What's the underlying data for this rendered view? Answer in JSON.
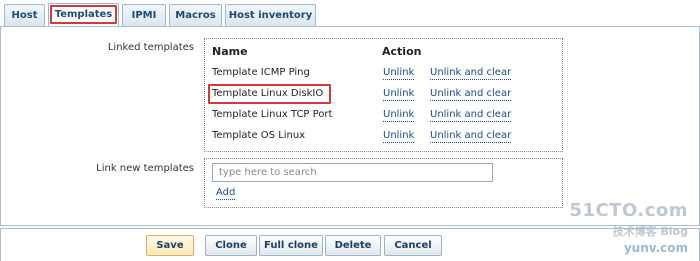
{
  "tabs": [
    {
      "label": "Host"
    },
    {
      "label": "Templates",
      "active": true
    },
    {
      "label": "IPMI"
    },
    {
      "label": "Macros"
    },
    {
      "label": "Host inventory"
    }
  ],
  "linked_templates": {
    "label": "Linked templates",
    "col_name": "Name",
    "col_action": "Action",
    "rows": [
      {
        "name": "Template ICMP Ping",
        "unlink": "Unlink",
        "unlink_clear": "Unlink and clear",
        "highlighted": false
      },
      {
        "name": "Template Linux DiskIO",
        "unlink": "Unlink",
        "unlink_clear": "Unlink and clear",
        "highlighted": true
      },
      {
        "name": "Template Linux TCP Port",
        "unlink": "Unlink",
        "unlink_clear": "Unlink and clear",
        "highlighted": false
      },
      {
        "name": "Template OS Linux",
        "unlink": "Unlink",
        "unlink_clear": "Unlink and clear",
        "highlighted": false
      }
    ]
  },
  "link_new": {
    "label": "Link new templates",
    "placeholder": "type here to search",
    "add_label": "Add"
  },
  "buttons": {
    "save": "Save",
    "clone": "Clone",
    "full_clone": "Full clone",
    "delete": "Delete",
    "cancel": "Cancel"
  },
  "watermark": {
    "line1": "51CTO.com",
    "line2": "技术博客  Blog",
    "line3": "yunv.com"
  },
  "colors": {
    "highlight": "#d13a3a",
    "link": "#1b4a86",
    "tab_text": "#1b4a73"
  }
}
